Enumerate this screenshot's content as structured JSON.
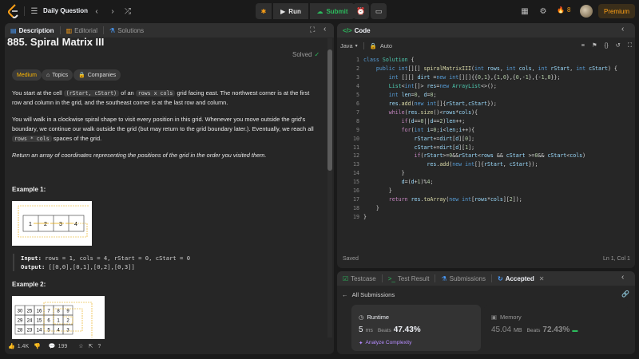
{
  "topbar": {
    "title": "Daily Question",
    "run_label": "Run",
    "submit_label": "Submit",
    "streak_count": "8",
    "premium_label": "Premium",
    "colors": {
      "accent": "#ffa116",
      "submit": "#2cbb5d"
    }
  },
  "desc_panel": {
    "tabs": [
      {
        "label": "Description",
        "icon": "document-icon"
      },
      {
        "label": "Editorial",
        "icon": "book-icon"
      },
      {
        "label": "Solutions",
        "icon": "flask-icon"
      }
    ],
    "title": "885. Spiral Matrix III",
    "status": "Solved",
    "chips": {
      "difficulty": "Medium",
      "topics": "Topics",
      "companies": "Companies"
    },
    "p1_a": "You start at the cell ",
    "p1_code1": "(rStart, cStart)",
    "p1_b": " of an ",
    "p1_code2": "rows x cols",
    "p1_c": " grid facing east. The northwest corner is at the first row and column in the grid, and the southeast corner is at the last row and column.",
    "p2_a": "You will walk in a clockwise spiral shape to visit every position in this grid. Whenever you move outside the grid's boundary, we continue our walk outside the grid (but may return to the grid boundary later.). Eventually, we reach all ",
    "p2_code": "rows * cols",
    "p2_b": " spaces of the grid.",
    "p3": "Return an array of coordinates representing the positions of the grid in the order you visited them.",
    "example1": {
      "title": "Example 1:",
      "cells": [
        "1",
        "2",
        "3",
        "4"
      ],
      "input_label": "Input:",
      "input": "rows = 1, cols = 4, rStart = 0, cStart = 0",
      "output_label": "Output:",
      "output": "[[0,0],[0,1],[0,2],[0,3]]"
    },
    "example2": {
      "title": "Example 2:",
      "grid": [
        [
          "30",
          "25",
          "16",
          "7",
          "8",
          "9"
        ],
        [
          "29",
          "24",
          "15",
          "6",
          "1",
          "2"
        ],
        [
          "28",
          "23",
          "14",
          "5",
          "4",
          "3"
        ]
      ]
    },
    "footer": {
      "likes": "1.4K",
      "comments": "199"
    }
  },
  "code_panel": {
    "tab_label": "Code",
    "language": "Java",
    "autocomplete": "Auto",
    "line_numbers": [
      "1",
      "2",
      "3",
      "4",
      "5",
      "6",
      "7",
      "8",
      "9",
      "10",
      "11",
      "12",
      "13",
      "14",
      "15",
      "16",
      "17",
      "18",
      "19"
    ],
    "status": "Saved",
    "cursor": "Ln 1, Col 1"
  },
  "result_panel": {
    "tabs": [
      {
        "label": "Testcase",
        "icon": "check-square-icon"
      },
      {
        "label": "Test Result",
        "icon": "terminal-icon"
      },
      {
        "label": "Submissions",
        "icon": "flask-icon"
      },
      {
        "label": "Accepted",
        "icon": "history-icon"
      }
    ],
    "back_label": "All Submissions",
    "runtime": {
      "label": "Runtime",
      "value": "5",
      "unit": "ms",
      "beats": "Beats",
      "percent": "47.43%",
      "analyze": "Analyze Complexity"
    },
    "memory": {
      "label": "Memory",
      "value": "45.04",
      "unit": "MB",
      "beats": "Beats",
      "percent": "72.43%"
    }
  }
}
